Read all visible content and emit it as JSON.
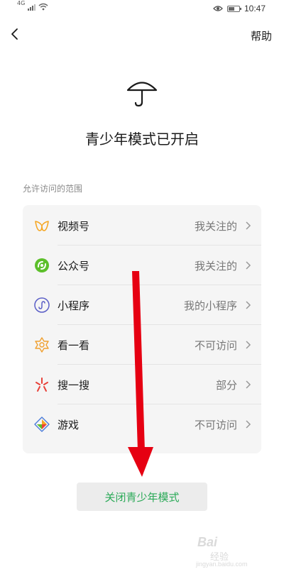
{
  "status_bar": {
    "network": "4G",
    "time": "10:47",
    "battery_level": 0.6
  },
  "nav": {
    "help_label": "帮助"
  },
  "title": "青少年模式已开启",
  "section_label": "允许访问的范围",
  "items": [
    {
      "label": "视频号",
      "value": "我关注的",
      "icon": "video-channel-icon",
      "color": "#f5a623"
    },
    {
      "label": "公众号",
      "value": "我关注的",
      "icon": "official-account-icon",
      "color": "#5cbf2a"
    },
    {
      "label": "小程序",
      "value": "我的小程序",
      "icon": "mini-program-icon",
      "color": "#5b5fc7"
    },
    {
      "label": "看一看",
      "value": "不可访问",
      "icon": "top-stories-icon",
      "color": "#f0a030"
    },
    {
      "label": "搜一搜",
      "value": "部分",
      "icon": "search-icon",
      "color": "#e8423a"
    },
    {
      "label": "游戏",
      "value": "不可访问",
      "icon": "game-icon",
      "color": "#4a7bd9"
    }
  ],
  "close_button_label": "关闭青少年模式",
  "colors": {
    "accent_green": "#2aa957",
    "arrow_red": "#e60012"
  },
  "watermark": {
    "brand": "Bai",
    "sub": "经验",
    "url": "jingyan.baidu.com"
  }
}
